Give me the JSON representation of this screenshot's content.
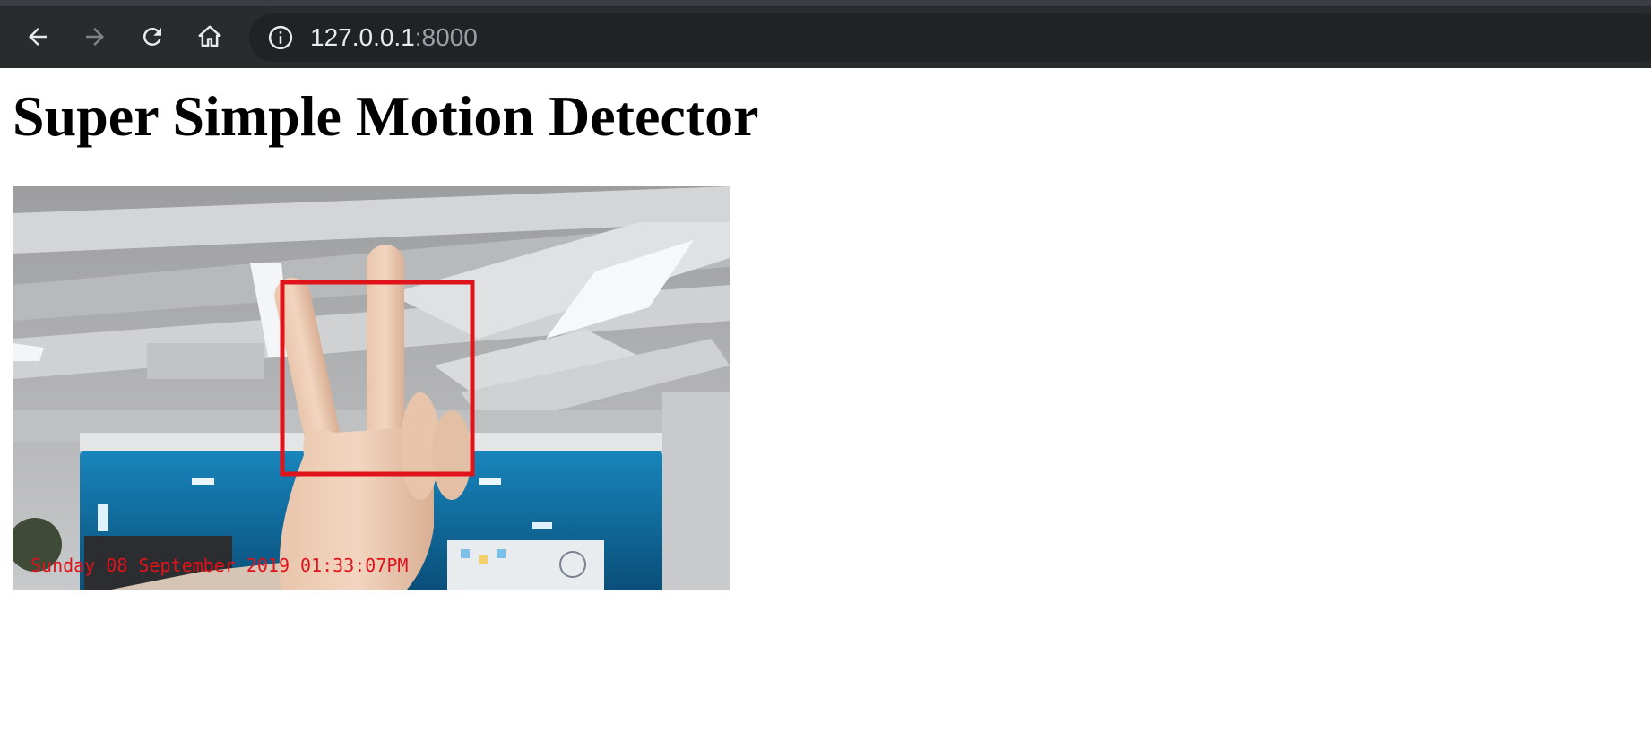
{
  "browser": {
    "back_icon": "arrow-left-icon",
    "forward_icon": "arrow-right-icon",
    "reload_icon": "reload-icon",
    "home_icon": "home-icon",
    "info_icon": "info-icon",
    "url_host": "127.0.0.1",
    "url_port": ":8000",
    "forward_enabled": false
  },
  "page": {
    "title": "Super Simple Motion Detector",
    "video": {
      "timestamp": "Sunday 08 September 2019 01:33:07PM",
      "detection_box_color": "#e0121a"
    }
  }
}
